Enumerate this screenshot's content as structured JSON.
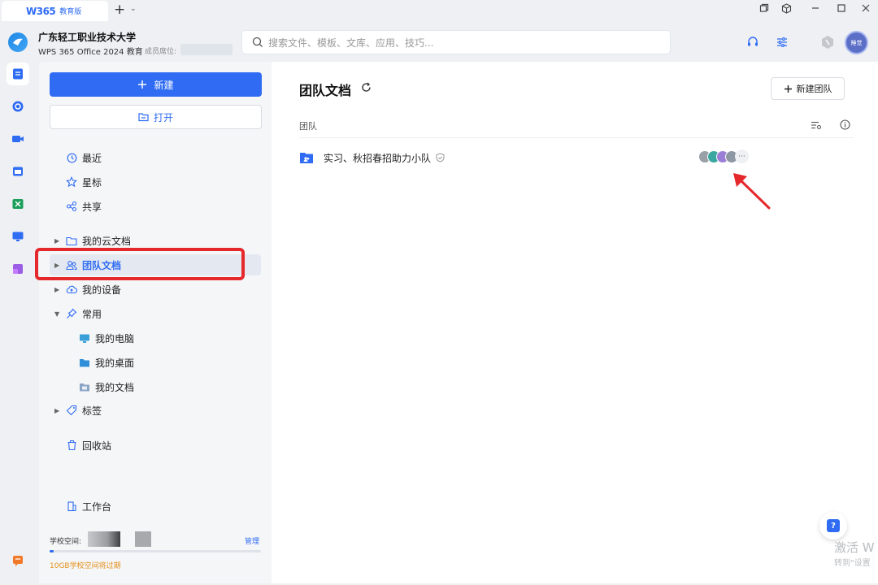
{
  "tab": {
    "logo": "W365",
    "edition": "教育版",
    "add_label": "+",
    "more_label": "⌄"
  },
  "header": {
    "org_name": "广东轻工职业技术大学",
    "product": "WPS 365 Office 2024 教育",
    "seat_label": "成员席位:",
    "search_placeholder": "搜索文件、模板、文库、应用、技巧...",
    "avatar_text": "睡觉"
  },
  "sidebar": {
    "new_label": "新建",
    "open_label": "打开",
    "items": {
      "recent": "最近",
      "starred": "星标",
      "shared": "共享",
      "my_cloud": "我的云文档",
      "team_docs": "团队文档",
      "my_devices": "我的设备",
      "common": "常用",
      "my_computer": "我的电脑",
      "my_desktop": "我的桌面",
      "my_documents": "我的文档",
      "tags": "标签",
      "recycle": "回收站",
      "workbench": "工作台"
    },
    "storage_label": "学校空间:",
    "manage_label": "管理",
    "storage_used_fraction": 0.02,
    "expire_text": "10GB学校空间将过期"
  },
  "main": {
    "title": "团队文档",
    "new_team_label": "新建团队",
    "column_header": "团队",
    "teams": [
      {
        "name": "实习、秋招春招助力小队"
      }
    ],
    "member_colors": [
      "#9aa0a8",
      "#3aa8a0",
      "#9b7fd6",
      "#8e98a4"
    ],
    "more_label": "···"
  },
  "watermark": {
    "line1": "激活 W",
    "line2": "转到\"设置"
  },
  "colors": {
    "accent": "#2f6cf3",
    "highlight": "#e5282c",
    "arrow": "#e5282c"
  }
}
